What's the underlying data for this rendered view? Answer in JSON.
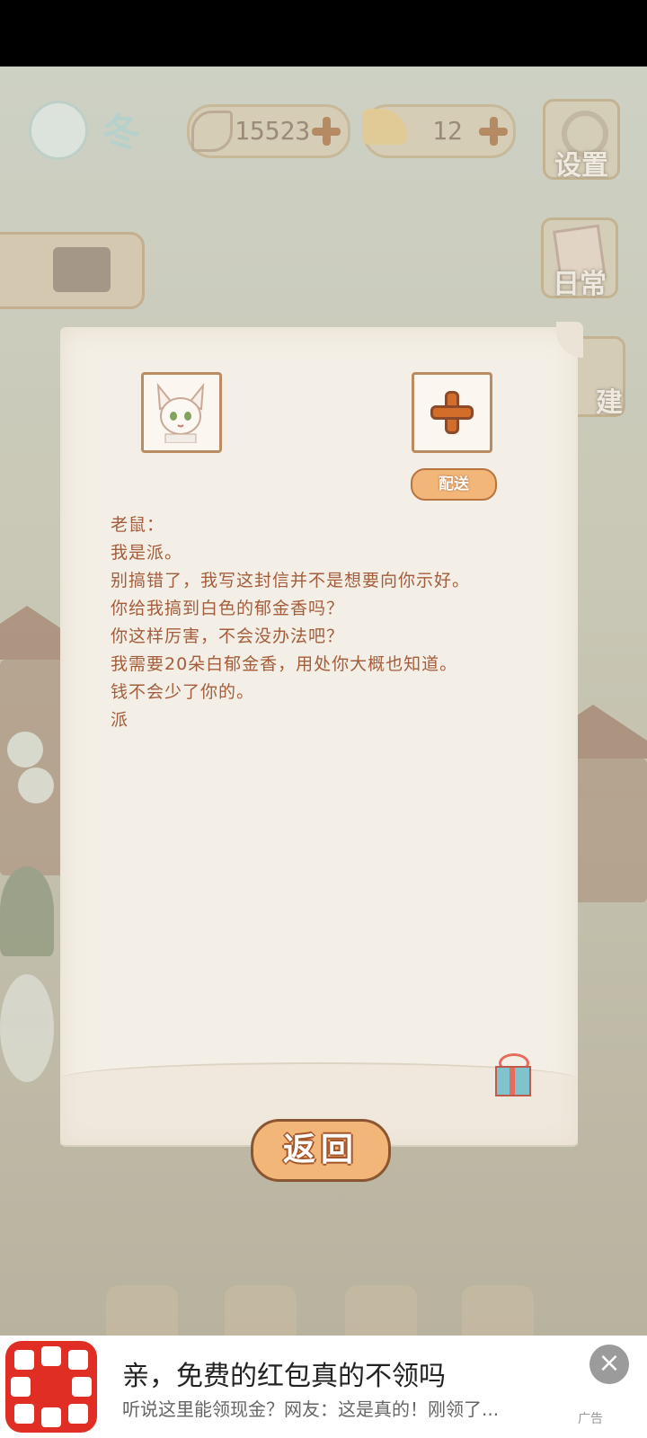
{
  "hud": {
    "season_label": "冬",
    "fish_coins": "15523",
    "cheese": "12",
    "settings_label": "设置",
    "daily_label": "日常",
    "build_label": "建"
  },
  "letter": {
    "deliver_label": "配送",
    "lines": [
      "老鼠：",
      "我是派。",
      "别搞错了，我写这封信并不是想要向你示好。",
      "你给我搞到白色的郁金香吗？",
      "你这样厉害，不会没办法吧？",
      "我需要20朵白郁金香，用处你大概也知道。",
      "钱不会少了你的。",
      "派"
    ],
    "back_label": "返回"
  },
  "ad": {
    "title": "亲，免费的红包真的不领吗",
    "description": "听说这里能领现金？网友：这是真的！刚领了...",
    "tag": "广告",
    "close_symbol": "×"
  },
  "colors": {
    "letter_text": "#a35d3c",
    "button_fill": "#f3b679",
    "plus_orange": "#d36d2a",
    "ad_brand": "#e02e24"
  },
  "icons": [
    "fish-bone-icon",
    "cheese-icon",
    "gear-icon",
    "briefcase-icon",
    "note-icon",
    "gift-icon",
    "close-icon"
  ]
}
